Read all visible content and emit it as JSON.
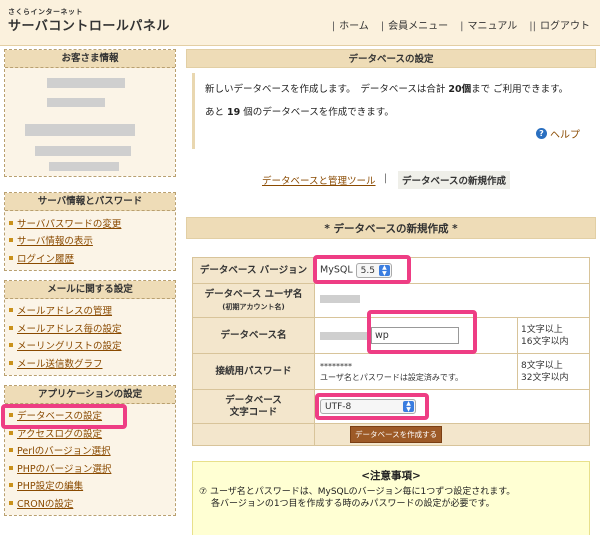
{
  "header": {
    "brand_small": "さくらインターネット",
    "brand_title": "サーバコントロールパネル",
    "nav": [
      {
        "label": "ホーム",
        "sep": "|"
      },
      {
        "label": "会員メニュー",
        "sep": "|"
      },
      {
        "label": "マニュアル",
        "sep": "|"
      },
      {
        "label": "ログアウト",
        "sep": "||"
      }
    ]
  },
  "sidebar": {
    "customer_title": "お客さま情報",
    "server_title": "サーバ情報とパスワード",
    "server_items": [
      "サーバパスワードの変更",
      "サーバ情報の表示",
      "ログイン履歴"
    ],
    "mail_title": "メールに関する設定",
    "mail_items": [
      "メールアドレスの管理",
      "メールアドレス毎の設定",
      "メーリングリストの設定",
      "メール送信数グラフ"
    ],
    "app_title": "アプリケーションの設定",
    "app_items": [
      "データベースの設定",
      "アクセスログの設定",
      "Perlのバージョン選択",
      "PHPのバージョン選択",
      "PHP設定の編集",
      "CRONの設定"
    ]
  },
  "main": {
    "title": "データベースの設定",
    "info_line1_a": "新しいデータベースを作成します。　データベースは合計 ",
    "info_line1_b": "20個",
    "info_line1_c": "まで ご利用できます。",
    "info_line2_a": "あと ",
    "info_line2_b": "19",
    "info_line2_c": " 個のデータベースを作成できます。",
    "help_label": "ヘルプ",
    "help_icon_glyph": "?",
    "tab_manage": "データベースと管理ツール",
    "tab_sep": "|",
    "tab_create": "データベースの新規作成",
    "section_title": "* データベースの新規作成 *"
  },
  "form": {
    "version_label": "データベース バージョン",
    "version_db": "MySQL",
    "version_value": "5.5",
    "user_label": "データベース ユーザ名",
    "user_sublabel": "(初期アカウント名)",
    "name_label": "データベース名",
    "name_value": "wp",
    "name_note1": "1文字以上",
    "name_note2": "16文字以内",
    "pw_label": "接続用パスワード",
    "pw_value": "********",
    "pw_hint": "ユーザ名とパスワードは設定済みです。",
    "pw_note1": "8文字以上",
    "pw_note2": "32文字以内",
    "charset_label1": "データベース",
    "charset_label2": "文字コード",
    "charset_value": "UTF-8",
    "submit_label": "データベースを作成する"
  },
  "notice": {
    "title": "<注意事項>",
    "line1": "ユーザ名とパスワードは、MySQLのバージョン毎に1つずつ設定されます。",
    "line2": "各バージョンの1つ目を作成する時のみパスワードの設定が必要です。"
  },
  "colors": {
    "highlight": "#ee3d84",
    "panel_header": "#eedcb7",
    "link": "#8a4a00",
    "submit": "#9d5a27"
  }
}
